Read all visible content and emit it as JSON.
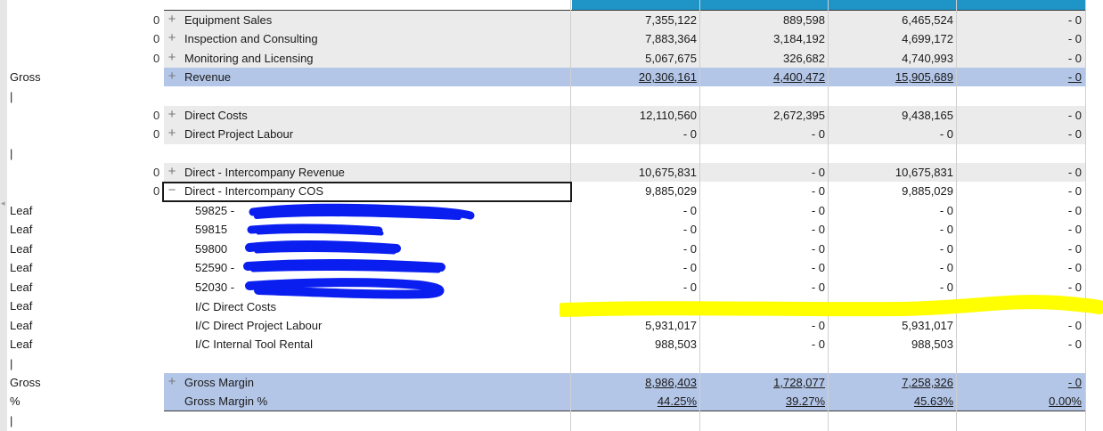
{
  "left_labels": {
    "gross_1": "Gross",
    "bar_1": "|",
    "bar_2": "|",
    "leaf_1": "Leaf",
    "leaf_2": "Leaf",
    "leaf_3": "Leaf",
    "leaf_4": "Leaf",
    "leaf_5": "Leaf",
    "leaf_6": "Leaf",
    "leaf_7": "Leaf",
    "leaf_8": "Leaf",
    "bar_3": "|",
    "gross_2": "Gross",
    "pct": "%",
    "bar_4": "|"
  },
  "colors": {
    "header_teal": "#1e94c7",
    "subtotal_blue": "#b4c6e7",
    "alt_grey": "#ebebeb",
    "highlighter_yellow": "#ffff00",
    "redaction_blue": "#0a1ef0"
  },
  "rows": {
    "equipment_sales": {
      "zero": "0",
      "icon": "plus",
      "label": "Equipment Sales",
      "values": [
        "7,355,122",
        "889,598",
        "6,465,524",
        "- 0"
      ]
    },
    "inspection_consulting": {
      "zero": "0",
      "icon": "plus",
      "label": "Inspection and Consulting",
      "values": [
        "7,883,364",
        "3,184,192",
        "4,699,172",
        "- 0"
      ]
    },
    "monitoring_licensing": {
      "zero": "0",
      "icon": "plus",
      "label": "Monitoring and Licensing",
      "values": [
        "5,067,675",
        "326,682",
        "4,740,993",
        "- 0"
      ]
    },
    "revenue": {
      "icon": "plus",
      "label": "Revenue",
      "values": [
        "20,306,161",
        "4,400,472",
        "15,905,689",
        "- 0"
      ]
    },
    "direct_costs": {
      "zero": "0",
      "icon": "plus",
      "label": "Direct Costs",
      "values": [
        "12,110,560",
        "2,672,395",
        "9,438,165",
        "- 0"
      ]
    },
    "direct_project_labour": {
      "zero": "0",
      "icon": "plus",
      "label": "Direct Project Labour",
      "values": [
        "- 0",
        "- 0",
        "- 0",
        "- 0"
      ]
    },
    "ic_revenue": {
      "zero": "0",
      "icon": "plus",
      "label": "Direct - Intercompany Revenue",
      "values": [
        "10,675,831",
        "- 0",
        "10,675,831",
        "- 0"
      ]
    },
    "ic_cos": {
      "zero": "0",
      "icon": "minus",
      "label": "Direct - Intercompany COS",
      "values": [
        "9,885,029",
        "- 0",
        "9,885,029",
        "- 0"
      ]
    },
    "leaf_59825": {
      "label": "59825 -",
      "values": [
        "- 0",
        "- 0",
        "- 0",
        "- 0"
      ]
    },
    "leaf_59815": {
      "label": "59815",
      "values": [
        "- 0",
        "- 0",
        "- 0",
        "- 0"
      ]
    },
    "leaf_59800": {
      "label": "59800",
      "values": [
        "- 0",
        "- 0",
        "- 0",
        "- 0"
      ]
    },
    "leaf_52590": {
      "label": "52590 -",
      "values": [
        "- 0",
        "- 0",
        "- 0",
        "- 0"
      ]
    },
    "leaf_52030": {
      "label": "52030 -",
      "values": [
        "- 0",
        "- 0",
        "- 0",
        "- 0"
      ]
    },
    "ic_direct_costs": {
      "label": "I/C Direct Costs"
    },
    "ic_direct_project_labour": {
      "label": "I/C Direct Project Labour",
      "values": [
        "5,931,017",
        "- 0",
        "5,931,017",
        "- 0"
      ]
    },
    "ic_internal_tool_rental": {
      "label": "I/C Internal Tool Rental",
      "values": [
        "988,503",
        "- 0",
        "988,503",
        "- 0"
      ]
    },
    "gross_margin": {
      "icon": "plus",
      "label": "Gross Margin",
      "values": [
        "8,986,403",
        "1,728,077",
        "7,258,326",
        "- 0"
      ]
    },
    "gross_margin_pct": {
      "label": "Gross Margin %",
      "values": [
        "44.25%",
        "39.27%",
        "45.63%",
        "0.00%"
      ]
    }
  }
}
